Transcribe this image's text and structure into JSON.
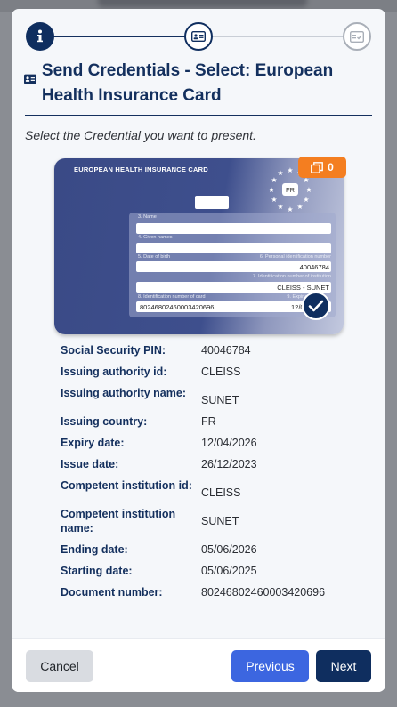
{
  "stepper": {
    "steps": [
      {
        "icon": "info-icon",
        "state": "done"
      },
      {
        "icon": "id-card-icon",
        "state": "active"
      },
      {
        "icon": "checklist-icon",
        "state": "pending"
      }
    ]
  },
  "header": {
    "title": "Send Credentials - Select: European Health Insurance Card",
    "subtitle": "Select the Credential you want to present."
  },
  "card": {
    "heading": "EUROPEAN HEALTH INSURANCE CARD",
    "country_code": "FR",
    "badge_count": "0",
    "fields": {
      "name_label": "3. Name",
      "given_names_label": "4. Given names",
      "dob_label": "5. Date of birth",
      "pin_label": "6. Personal identification number",
      "pin_value": "40046784",
      "institution_label": "7. Identification number of institution",
      "institution_value": "CLEISS - SUNET",
      "card_id_label": "8. Identification number of card",
      "card_id_value": "80246802460003420696",
      "expiry_label": "9. Expiry date",
      "expiry_value_partial": "12/0"
    },
    "colors": {
      "badge": "#f47e20",
      "card": "#3e4f8d"
    }
  },
  "details": [
    {
      "label": "Social Security PIN:",
      "value": "40046784"
    },
    {
      "label": "Issuing authority id:",
      "value": "CLEISS"
    },
    {
      "label": "Issuing authority name:",
      "value": "SUNET"
    },
    {
      "label": "Issuing country:",
      "value": "FR"
    },
    {
      "label": "Expiry date:",
      "value": "12/04/2026"
    },
    {
      "label": "Issue date:",
      "value": "26/12/2023"
    },
    {
      "label": "Competent institution id:",
      "value": "CLEISS"
    },
    {
      "label": "Competent institution name:",
      "value": "SUNET"
    },
    {
      "label": "Ending date:",
      "value": "05/06/2026"
    },
    {
      "label": "Starting date:",
      "value": "05/06/2025"
    },
    {
      "label": "Document number:",
      "value": "80246802460003420696"
    }
  ],
  "footer": {
    "cancel_label": "Cancel",
    "previous_label": "Previous",
    "next_label": "Next"
  },
  "colors": {
    "primary": "#0f2e5f",
    "secondary_button": "#3c66e0",
    "cancel_button": "#d9dce1"
  }
}
